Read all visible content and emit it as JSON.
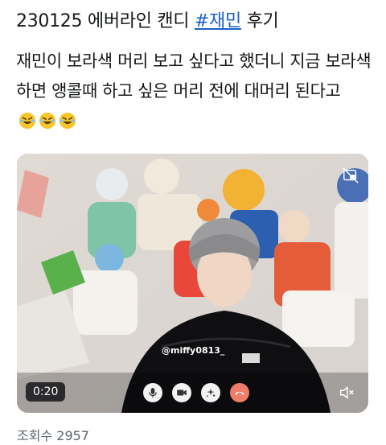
{
  "post": {
    "title_prefix": "230125 에버라인 캔디 ",
    "hashtag": "#재민",
    "title_suffix": " 후기",
    "body": "재민이 보라색 머리 보고 싶다고 했더니 지금 보라색 하면 앵콜때 하고 싶은 머리 전에 대머리 된다고",
    "emoji": [
      "rolling-on-floor-laughing",
      "rolling-on-floor-laughing",
      "rolling-on-floor-laughing"
    ]
  },
  "video": {
    "watermark": "@miffy0813_",
    "elapsed": "0:20",
    "controls": [
      "microphone-icon",
      "camera-icon",
      "effects-icon",
      "end-call-icon"
    ],
    "colors": {
      "end_call": "#f07c6a",
      "control_bg": "#f2f2f2"
    }
  },
  "footer": {
    "views_label": "조회수",
    "views_count": "2957"
  }
}
